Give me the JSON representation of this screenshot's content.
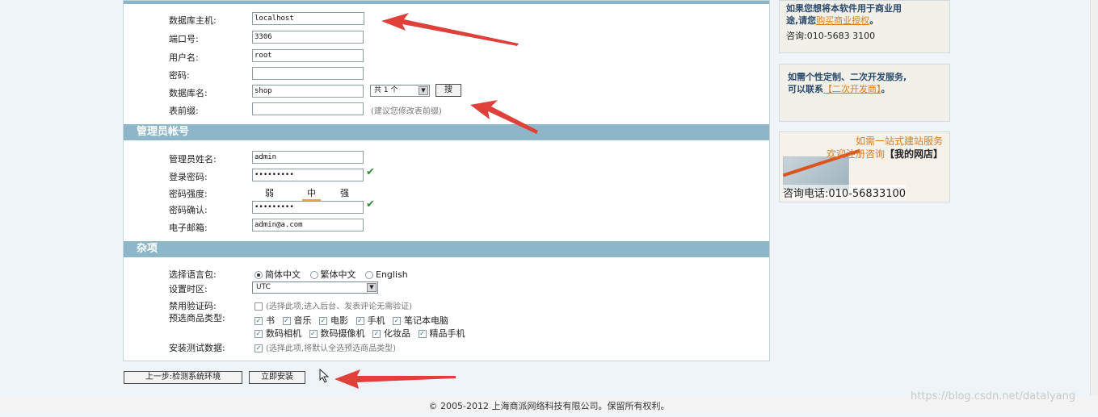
{
  "db": {
    "host_label": "数据库主机:",
    "host_value": "localhost",
    "port_label": "端口号:",
    "port_value": "3306",
    "user_label": "用户名:",
    "user_value": "root",
    "pass_label": "密码:",
    "name_label": "数据库名:",
    "name_value": "shop",
    "count_select": "共 1 个",
    "search_button": "搜",
    "prefix_label": "表前缀:",
    "prefix_hint": "(建议您修改表前缀)"
  },
  "admin": {
    "section_title": "管理员帐号",
    "name_label": "管理员姓名:",
    "name_value": "admin",
    "pass_label": "登录密码:",
    "pass_value": "•••••••••",
    "strength_label": "密码强度:",
    "strength_weak": "弱",
    "strength_mid": "中",
    "strength_strong": "强",
    "confirm_label": "密码确认:",
    "confirm_value": "•••••••••",
    "email_label": "电子邮箱:",
    "email_value": "admin@a.com"
  },
  "misc": {
    "section_title": "杂项",
    "lang_label": "选择语言包:",
    "lang_options": [
      "简体中文",
      "繁体中文",
      "English"
    ],
    "tz_label": "设置时区:",
    "tz_value": "UTC",
    "captcha_label": "禁用验证码:",
    "captcha_hint": "(选择此项,进入后台、发表评论无需验证)",
    "goods_label": "预选商品类型:",
    "goods_row1": [
      "书",
      "音乐",
      "电影",
      "手机",
      "笔记本电脑"
    ],
    "goods_row2": [
      "数码相机",
      "数码摄像机",
      "化妆品",
      "精品手机"
    ],
    "test_label": "安装测试数据:",
    "test_hint": "(选择此项,将默认全选预选商品类型)"
  },
  "actions": {
    "prev": "上一步:检测系统环境",
    "install": "立即安装"
  },
  "sidebar": {
    "box1_line1": "如果您想将本软件用于商业用",
    "box1_line2a": "途,请您",
    "box1_link": "购买商业授权",
    "box1_line2b": "。",
    "box1_tel": "咨询:010-5683 3100",
    "box2_line1": "如需个性定制、二次开发服务,",
    "box2_line2a": "可以联系",
    "box2_link": "【二次开发商】",
    "box2_line2b": "。",
    "ad_line1": "如需一站式建站服务",
    "ad_line2a": "欢迎注册咨询",
    "ad_line2b": "【我的网店】",
    "ad_tel": "咨询电话:010-56833100"
  },
  "footer": "© 2005-2012 上海商派网络科技有限公司。保留所有权利。",
  "watermark": "https://blog.csdn.net/datalyang"
}
